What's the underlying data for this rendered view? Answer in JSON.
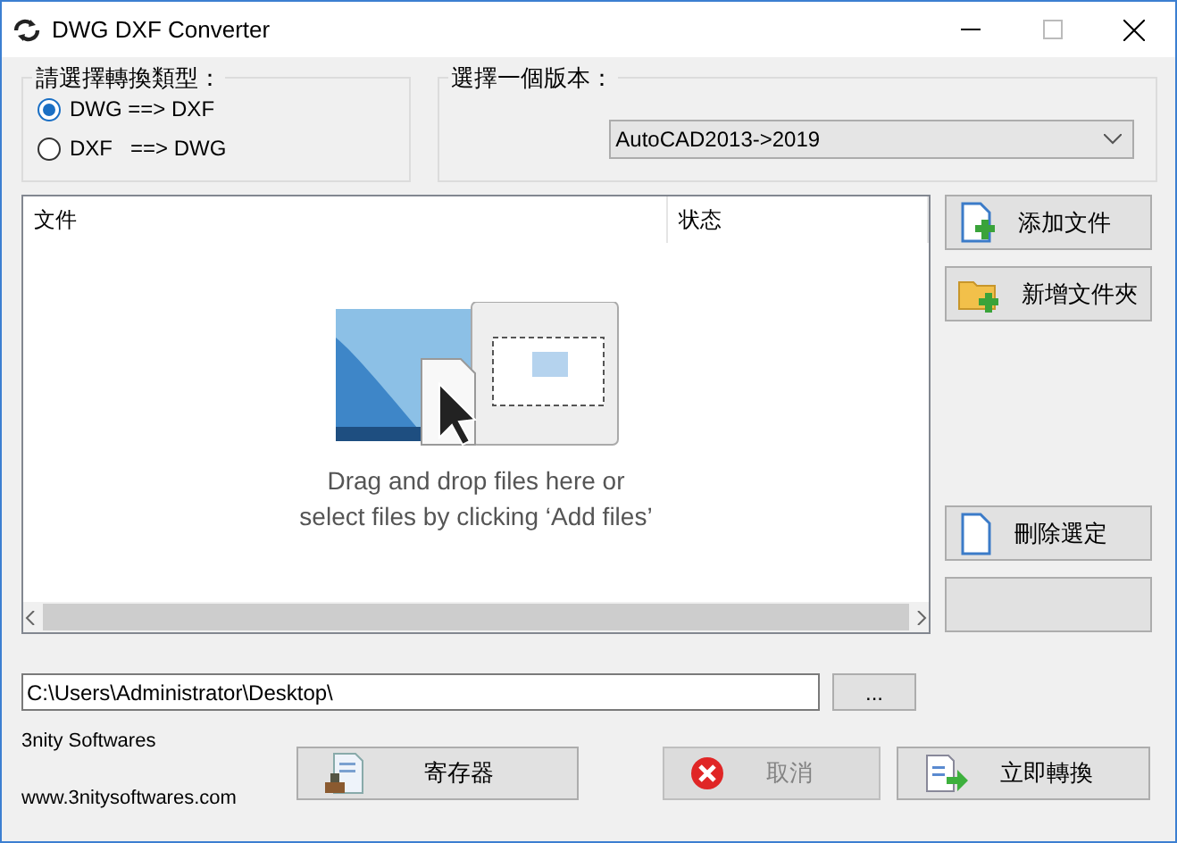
{
  "window": {
    "title": "DWG DXF Converter"
  },
  "conversion_type": {
    "label": "請選擇轉換類型：",
    "options": [
      {
        "label": "DWG ==> DXF",
        "selected": true
      },
      {
        "label": "DXF   ==> DWG",
        "selected": false
      }
    ]
  },
  "version": {
    "label": "選擇一個版本：",
    "value": "AutoCAD2013->2019"
  },
  "file_list": {
    "columns": [
      "文件",
      "状态"
    ],
    "hint_lines": [
      "Drag and drop files here or",
      "select files by clicking ‘Add files’"
    ]
  },
  "side_buttons": [
    {
      "kind": "add-file",
      "label": "添加文件"
    },
    {
      "kind": "add-folder",
      "label": "新增文件夾"
    },
    {
      "kind": "delete",
      "label": "刪除選定"
    },
    {
      "kind": "blank"
    }
  ],
  "output_path": {
    "value": "C:\\Users\\Administrator\\Desktop\\",
    "browse": "..."
  },
  "footer": {
    "company": "3nity Softwares",
    "website": "www.3nitysoftwares.com"
  },
  "bottom_buttons": [
    {
      "kind": "register",
      "label": "寄存器",
      "disabled": false
    },
    {
      "kind": "cancel",
      "label": "取消",
      "disabled": true
    },
    {
      "kind": "convert",
      "label": "立即轉換",
      "disabled": false
    }
  ]
}
